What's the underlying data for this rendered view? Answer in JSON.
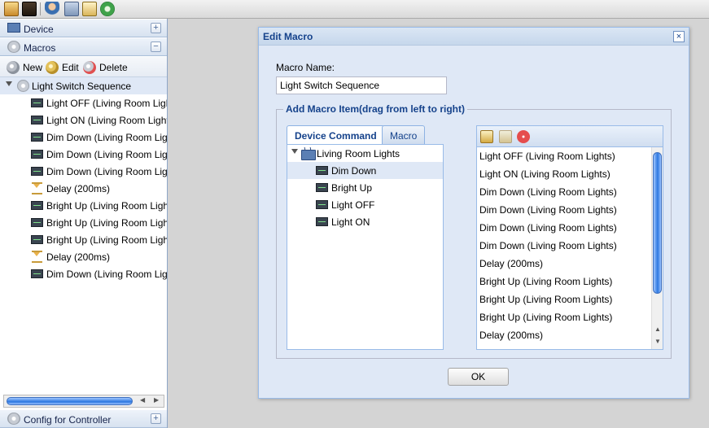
{
  "toolbar": {
    "icons": [
      "home-icon",
      "device-file-icon",
      "user-icon",
      "save-icon",
      "document-icon",
      "sync-icon"
    ]
  },
  "sidebar": {
    "device_header": "Device",
    "macros_header": "Macros",
    "macro_toolbar": {
      "new_label": "New",
      "edit_label": "Edit",
      "delete_label": "Delete"
    },
    "tree": {
      "root_label": "Light Switch Sequence",
      "items": [
        {
          "label": "Light OFF (Living Room Lights)",
          "type": "command"
        },
        {
          "label": "Light ON (Living Room Lights)",
          "type": "command"
        },
        {
          "label": "Dim Down (Living Room Lights)",
          "type": "command"
        },
        {
          "label": "Dim Down (Living Room Lights)",
          "type": "command"
        },
        {
          "label": "Dim Down (Living Room Lights)",
          "type": "command"
        },
        {
          "label": "Delay (200ms)",
          "type": "delay"
        },
        {
          "label": "Bright Up (Living Room Lights)",
          "type": "command"
        },
        {
          "label": "Bright Up (Living Room Lights)",
          "type": "command"
        },
        {
          "label": "Bright Up (Living Room Lights)",
          "type": "command"
        },
        {
          "label": "Delay (200ms)",
          "type": "delay"
        },
        {
          "label": "Dim Down (Living Room Lights)",
          "type": "command"
        }
      ]
    },
    "config_header": "Config for Controller"
  },
  "dialog": {
    "title": "Edit Macro",
    "macro_name_label": "Macro Name:",
    "macro_name_value": "Light Switch Sequence",
    "fieldset_legend": "Add Macro Item(drag from left to right)",
    "tabs": [
      {
        "label": "Device Command",
        "active": true
      },
      {
        "label": "Macro",
        "active": false
      }
    ],
    "device_tree": {
      "device": "Living Room Lights",
      "commands": [
        "Dim Down",
        "Bright Up",
        "Light OFF",
        "Light ON"
      ]
    },
    "macro_items": [
      "Light OFF (Living Room Lights)",
      "Light ON (Living Room Lights)",
      "Dim Down (Living Room Lights)",
      "Dim Down (Living Room Lights)",
      "Dim Down (Living Room Lights)",
      "Dim Down (Living Room Lights)",
      "Delay (200ms)",
      "Bright Up (Living Room Lights)",
      "Bright Up (Living Room Lights)",
      "Bright Up (Living Room Lights)",
      "Delay (200ms)"
    ],
    "ok_label": "OK"
  }
}
